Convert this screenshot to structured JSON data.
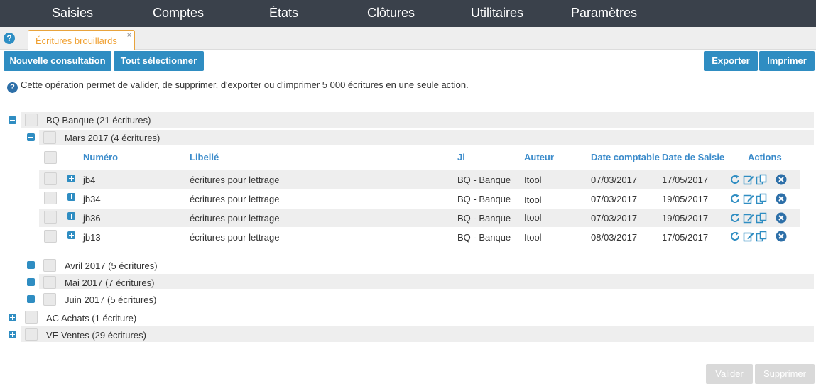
{
  "nav": {
    "items": [
      "Saisies",
      "Comptes",
      "États",
      "Clôtures",
      "Utilitaires",
      "Paramètres"
    ]
  },
  "tab": {
    "label": "Écritures brouillards",
    "close": "×"
  },
  "toolbar": {
    "new_consultation": "Nouvelle consultation",
    "select_all": "Tout sélectionner",
    "export": "Exporter",
    "print": "Imprimer"
  },
  "info_text": "Cette opération permet de valider, de supprimer, d'exporter ou d'imprimer 5 000 écritures en une seule action.",
  "tree": {
    "bq": "BQ Banque (21 écritures)",
    "mars": "Mars 2017 (4 écritures)",
    "avril": "Avril 2017 (5 écritures)",
    "mai": "Mai 2017 (7 écritures)",
    "juin": "Juin 2017 (5 écritures)",
    "ac": "AC Achats (1 écriture)",
    "ve": "VE Ventes (29 écritures)"
  },
  "table": {
    "columns": [
      "Numéro",
      "Libellé",
      "Jl",
      "Auteur",
      "Date comptable",
      "Date de Saisie",
      "Actions"
    ],
    "rows": [
      [
        "jb4",
        "écritures pour lettrage",
        "BQ - Banque",
        "Itool",
        "07/03/2017",
        "17/05/2017"
      ],
      [
        "jb34",
        "écritures pour lettrage",
        "BQ - Banque",
        "Itool",
        "07/03/2017",
        "19/05/2017"
      ],
      [
        "jb36",
        "écritures pour lettrage",
        "BQ - Banque",
        "Itool",
        "07/03/2017",
        "19/05/2017"
      ],
      [
        "jb13",
        "écritures pour lettrage",
        "BQ - Banque",
        "Itool",
        "08/03/2017",
        "17/05/2017"
      ]
    ]
  },
  "footer": {
    "validate": "Valider",
    "delete": "Supprimer"
  },
  "icons": {
    "refresh": "refresh-icon",
    "edit": "edit-icon",
    "copy": "copy-icon",
    "delete": "delete-icon",
    "help": "help-icon",
    "expand": "expand-icon",
    "collapse": "collapse-icon"
  },
  "colors": {
    "nav_bg": "#3a414b",
    "primary": "#2f8dc2",
    "tab_accent": "#f0a030",
    "header_text": "#3c8ccb",
    "row_shade": "#eeeeee"
  }
}
